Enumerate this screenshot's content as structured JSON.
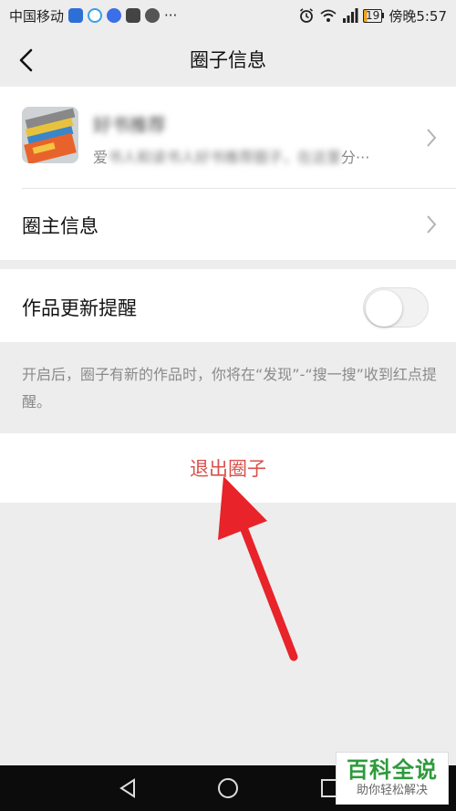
{
  "status_bar": {
    "carrier": "中国移动",
    "more": "···",
    "battery": "19",
    "time": "傍晚5:57"
  },
  "header": {
    "title": "圈子信息"
  },
  "circle": {
    "name": "好书推荐",
    "desc_prefix": "爱",
    "desc_blurred": "书人和读书人好书推荐圈子，在这里",
    "desc_suffix": "分···"
  },
  "owner_row": {
    "label": "圈主信息"
  },
  "update_reminder": {
    "label": "作品更新提醒",
    "enabled": false,
    "tip": "开启后，圈子有新的作品时，你将在“发现”-“搜一搜”收到红点提醒。"
  },
  "exit_button": {
    "label": "退出圈子"
  },
  "watermark": {
    "brand": "百科全说",
    "slogan": "助你轻松解决"
  },
  "colors": {
    "accent_red": "#d9514c",
    "arrow_red": "#e8232a",
    "background": "#ededed"
  }
}
